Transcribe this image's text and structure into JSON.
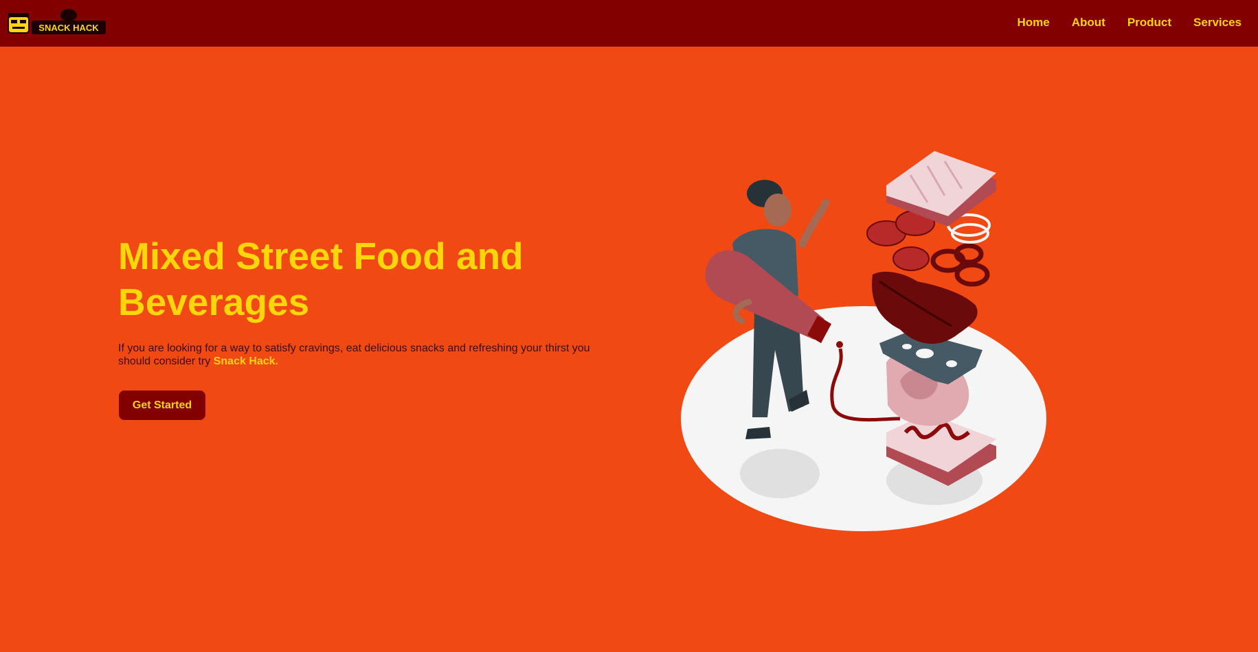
{
  "nav": {
    "logo_text": "SNACK HACK",
    "links": [
      {
        "label": "Home"
      },
      {
        "label": "About"
      },
      {
        "label": "Product"
      },
      {
        "label": "Services"
      }
    ]
  },
  "hero": {
    "title": "Mixed Street Food and Beverages",
    "description_prefix": "If you are looking for a way to satisfy cravings, eat delicious snacks and refreshing your thirst you should consider try ",
    "description_brand": "Snack Hack.",
    "cta_label": "Get Started"
  },
  "colors": {
    "background": "#f04914",
    "navbar": "#820000",
    "accent": "#ffd60a",
    "button": "#820000"
  },
  "icons": {
    "logo": "snack-hack-logo",
    "illustration": "sandwich-person-illustration"
  }
}
